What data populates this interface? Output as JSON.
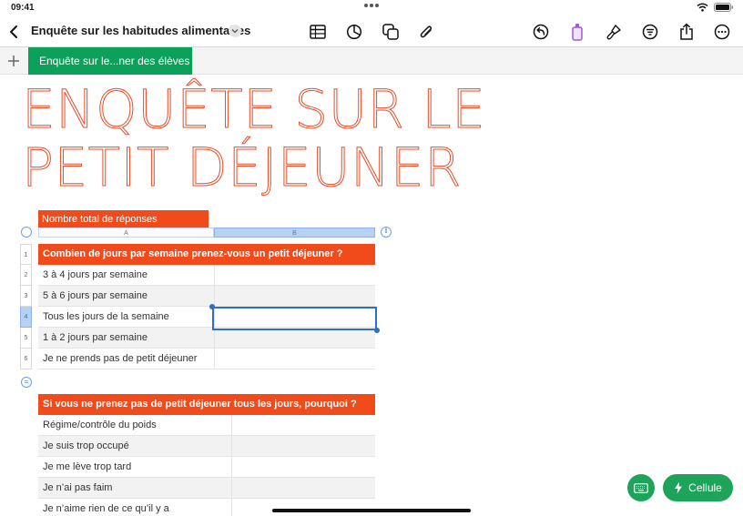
{
  "status_bar": {
    "time": "09:41"
  },
  "toolbar": {
    "document_title": "Enquête sur les habitudes alimentaires"
  },
  "sheet_tabs": {
    "active_tab": "Enquête sur le...ner des élèves"
  },
  "page_title": {
    "line1": "ENQUÊTE SUR LE",
    "line2": "PETIT DÉJEUNER"
  },
  "table1": {
    "title": "Nombre total de réponses",
    "column_headers": [
      "A",
      "B"
    ],
    "row_numbers": [
      "1",
      "2",
      "3",
      "4",
      "5",
      "6"
    ],
    "header": "Combien de jours par semaine prenez-vous un petit déjeuner ?",
    "rows": [
      "3 à 4 jours par semaine",
      "5 à 6 jours par semaine",
      "Tous les jours de la semaine",
      "1 à 2 jours par semaine",
      "Je ne prends pas de petit déjeuner"
    ],
    "selected_row": "4"
  },
  "table2": {
    "header": "Si vous ne prenez pas de petit déjeuner tous les jours, pourquoi ?",
    "rows": [
      "Régime/contrôle du poids",
      "Je suis trop occupé",
      "Je me lève trop tard",
      "Je n’ai pas faim",
      "Je n’aime rien de ce qu’il y a"
    ]
  },
  "buttons": {
    "cell_label": "Cellule"
  },
  "colors": {
    "accent_orange": "#f14b1c",
    "title_orange": "#ea4d27",
    "green": "#1ea35a",
    "selection_blue": "#2e6fc4"
  }
}
